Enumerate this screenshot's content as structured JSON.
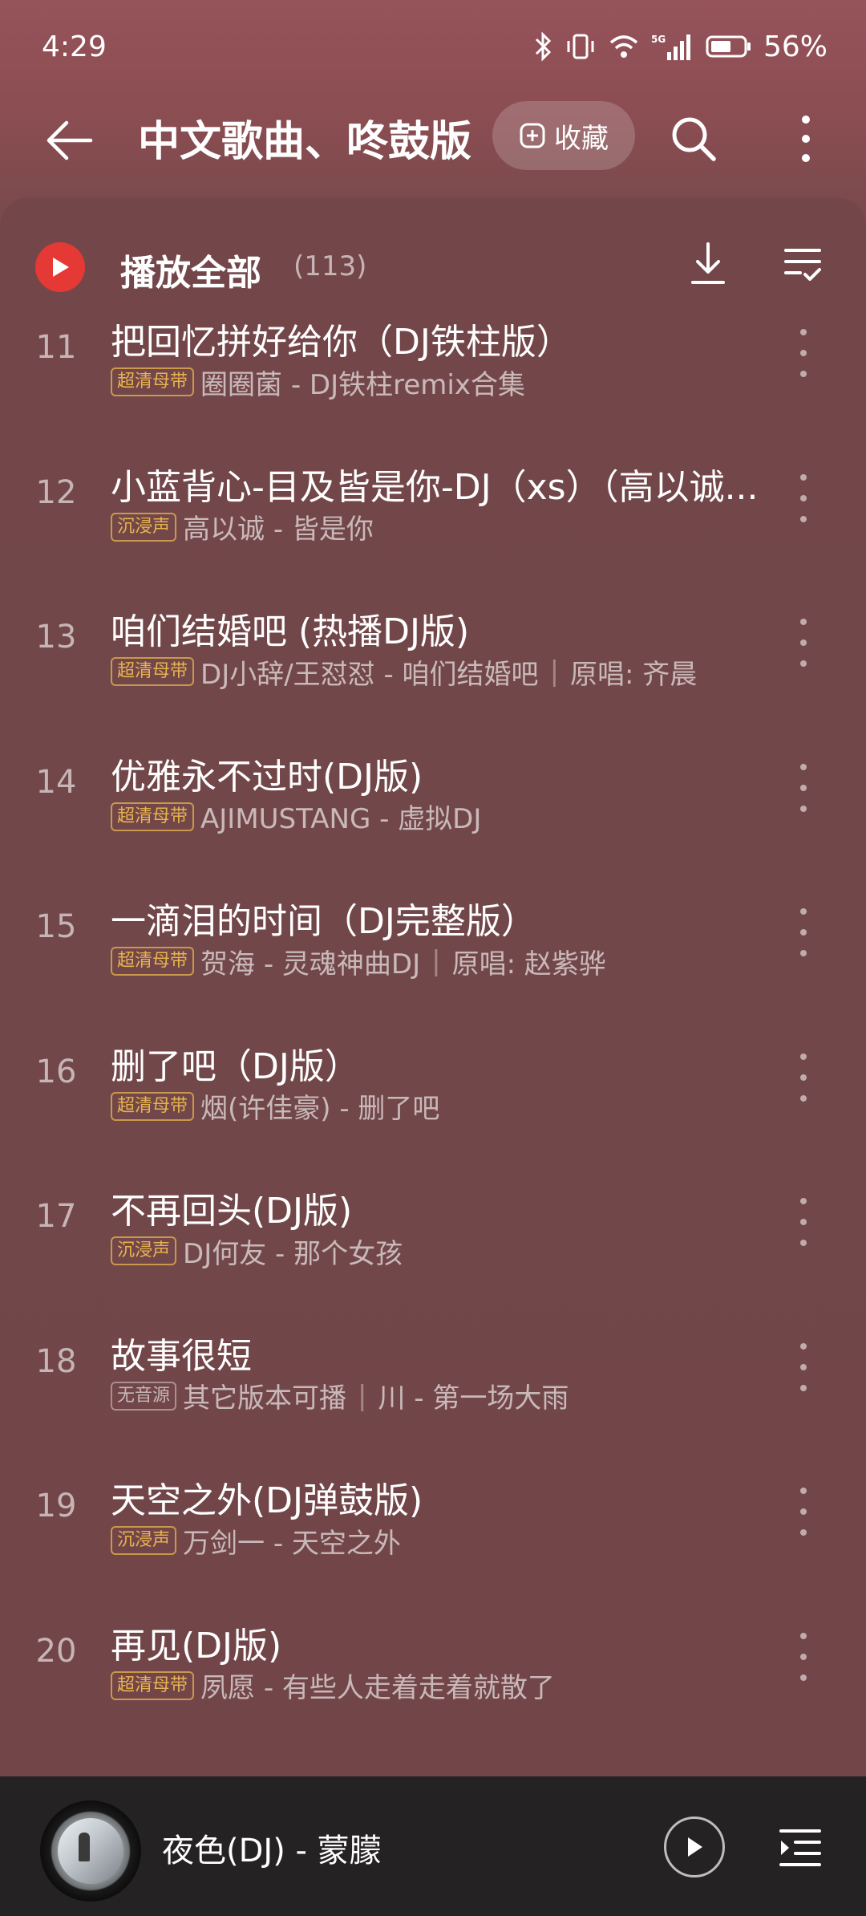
{
  "status_bar": {
    "time": "4:29",
    "battery_text": "56%",
    "network": "5G"
  },
  "header": {
    "title": "中文歌曲、咚鼓版",
    "collect_label": "收藏"
  },
  "play_all": {
    "label": "播放全部",
    "count": "(113)"
  },
  "songs": [
    {
      "num": "11",
      "title": "把回忆拼好给你（DJ铁柱版）",
      "badge": "超清母带",
      "badge_style": "gold",
      "meta": "圈圈菌 - DJ铁柱remix合集",
      "extra": ""
    },
    {
      "num": "12",
      "title": "小蓝背心-目及皆是你-DJ（xs）（高以诚...",
      "badge": "沉浸声",
      "badge_style": "gold",
      "meta": "高以诚 - 皆是你",
      "extra": ""
    },
    {
      "num": "13",
      "title": "咱们结婚吧 (热播DJ版)",
      "badge": "超清母带",
      "badge_style": "gold",
      "meta": "DJ小辞/王怼怼 - 咱们结婚吧",
      "extra": "原唱: 齐晨"
    },
    {
      "num": "14",
      "title": "优雅永不过时(DJ版)",
      "badge": "超清母带",
      "badge_style": "gold",
      "meta": "AJIMUSTANG - 虚拟DJ",
      "extra": ""
    },
    {
      "num": "15",
      "title": "一滴泪的时间（DJ完整版）",
      "badge": "超清母带",
      "badge_style": "gold",
      "meta": "贺海 - 灵魂神曲DJ",
      "extra": "原唱: 赵紫骅"
    },
    {
      "num": "16",
      "title": "删了吧（DJ版）",
      "badge": "超清母带",
      "badge_style": "gold",
      "meta": "烟(许佳豪) - 删了吧",
      "extra": ""
    },
    {
      "num": "17",
      "title": "不再回头(DJ版)",
      "badge": "沉浸声",
      "badge_style": "gold",
      "meta": "DJ何友 - 那个女孩",
      "extra": ""
    },
    {
      "num": "18",
      "title": "故事很短",
      "badge": "无音源",
      "badge_style": "grey",
      "meta": "其它版本可播",
      "extra": "川 - 第一场大雨"
    },
    {
      "num": "19",
      "title": "天空之外(DJ弹鼓版)",
      "badge": "沉浸声",
      "badge_style": "gold",
      "meta": "万剑一 - 天空之外",
      "extra": ""
    },
    {
      "num": "20",
      "title": "再见(DJ版)",
      "badge": "超清母带",
      "badge_style": "gold",
      "meta": "夙愿 - 有些人走着走着就散了",
      "extra": ""
    }
  ],
  "player": {
    "now_playing": "夜色(DJ) - 蒙朦"
  },
  "colors": {
    "accent_red": "#e53935",
    "badge_gold": "#e8b34e",
    "player_bg": "#252223"
  }
}
